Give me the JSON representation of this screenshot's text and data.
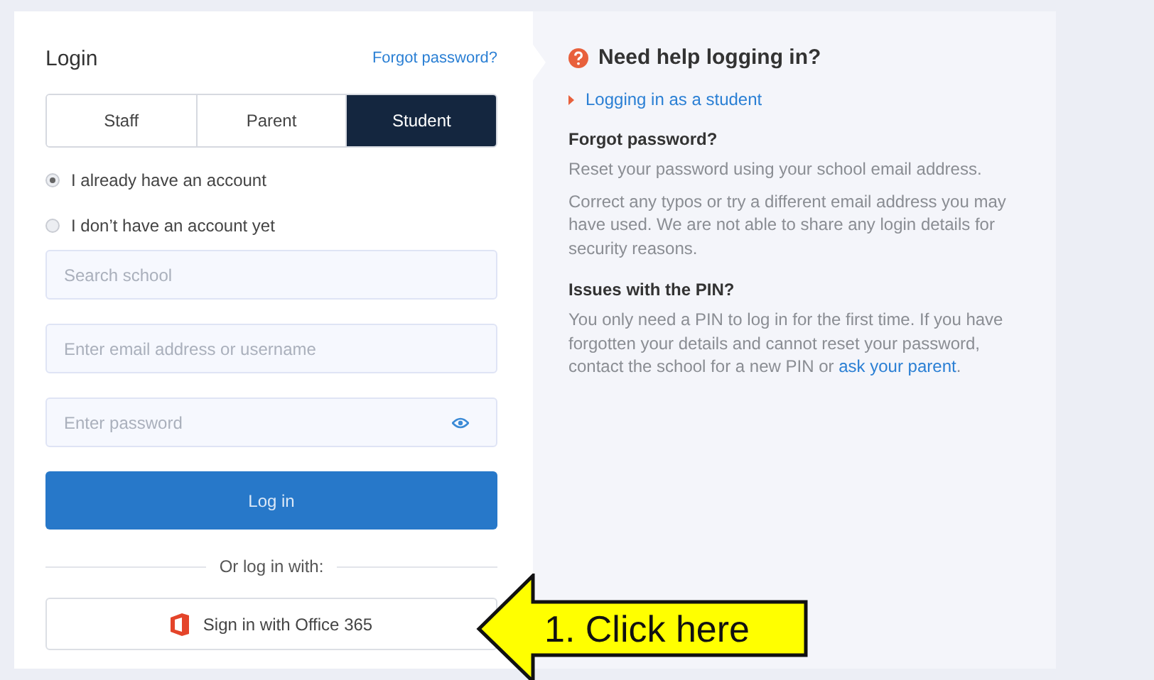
{
  "login": {
    "title": "Login",
    "forgot_link": "Forgot password?",
    "tabs": [
      {
        "label": "Staff",
        "selected": false
      },
      {
        "label": "Parent",
        "selected": false
      },
      {
        "label": "Student",
        "selected": true
      }
    ],
    "options": [
      {
        "label": "I already have an account",
        "selected": true
      },
      {
        "label": "I don’t have an account yet",
        "selected": false
      }
    ],
    "fields": [
      {
        "kind": "text",
        "placeholder": "Search school"
      },
      {
        "kind": "text",
        "placeholder": "Enter email address or username"
      },
      {
        "kind": "password",
        "placeholder": "Enter password"
      }
    ],
    "submit": "Log in",
    "divider": "Or log in with:",
    "sso_button": "Sign in with Office 365"
  },
  "help": {
    "title": "Need help logging in?",
    "link": "Logging in as a student",
    "sections": [
      {
        "heading": "Forgot password?",
        "paragraphs": [
          {
            "text": "Reset your password using your school email address."
          },
          {
            "text": "Correct any typos or try a different email address you may have used. We are not able to share any login details for security reasons."
          }
        ]
      },
      {
        "heading": "Issues with the PIN?",
        "paragraphs": [
          {
            "text": "You only need a PIN to log in for the first time. If you have forgotten your details and cannot reset your password, contact the school for a new PIN or ",
            "link": "ask your parent",
            "after": "."
          }
        ]
      }
    ]
  },
  "callout": {
    "text": "1. Click here"
  }
}
